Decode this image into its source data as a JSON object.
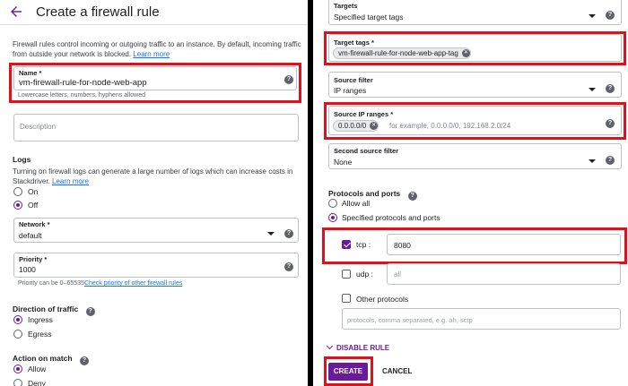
{
  "header": {
    "title": "Create a firewall rule"
  },
  "intro": {
    "text": "Firewall rules control incoming or outgoing traffic to an instance. By default, incoming traffic from outside your network is blocked.",
    "learn_more": "Learn more"
  },
  "name_field": {
    "label": "Name *",
    "value": "vm-firewall-rule-for-node-web-app",
    "hint": "Lowercase letters, numbers, hyphens allowed"
  },
  "description_field": {
    "placeholder": "Description"
  },
  "logs": {
    "title": "Logs",
    "text": "Turning on firewall logs can generate a large number of logs which can increase costs in Stackdriver.",
    "learn_more": "Learn more",
    "options": [
      "On",
      "Off"
    ],
    "selected": "Off"
  },
  "network_field": {
    "label": "Network *",
    "value": "default"
  },
  "priority_field": {
    "label": "Priority *",
    "value": "1000",
    "hint": "Priority can be 0–65535",
    "hint_link": "Check priority of other firewall rules"
  },
  "direction": {
    "title": "Direction of traffic",
    "options": [
      "Ingress",
      "Egress"
    ],
    "selected": "Ingress"
  },
  "action": {
    "title": "Action on match",
    "options": [
      "Allow",
      "Deny"
    ],
    "selected": "Allow"
  },
  "targets_field": {
    "label": "Targets",
    "value": "Specified target tags"
  },
  "target_tags_field": {
    "label": "Target tags *",
    "chip": "vm-firewall-rule-for-node-web-app-tag"
  },
  "source_filter_field": {
    "label": "Source filter",
    "value": "IP ranges"
  },
  "source_ip_field": {
    "label": "Source IP ranges *",
    "chip": "0.0.0.0/0",
    "placeholder": "for example, 0.0.0.0/0, 192.168.2.0/24"
  },
  "second_source_field": {
    "label": "Second source filter",
    "value": "None"
  },
  "protocols": {
    "title": "Protocols and ports",
    "options": [
      "Allow all",
      "Specified protocols and ports"
    ],
    "selected": "Specified protocols and ports",
    "tcp": {
      "label": "tcp :",
      "checked": true,
      "value": "8080"
    },
    "udp": {
      "label": "udp :",
      "checked": false,
      "placeholder": "all"
    },
    "other": {
      "label": "Other protocols",
      "checked": false,
      "placeholder": "protocols, comma separated, e.g. ah, sctp"
    }
  },
  "disable_rule": "DISABLE RULE",
  "buttons": {
    "create": "CREATE",
    "cancel": "CANCEL"
  },
  "colors": {
    "accent": "#6a1b9a",
    "highlight": "#e0111a",
    "link": "#1a73e8"
  },
  "icons": [
    "back-arrow-icon",
    "help-icon",
    "dropdown-icon",
    "chip-remove-icon",
    "chevron-down-icon"
  ]
}
